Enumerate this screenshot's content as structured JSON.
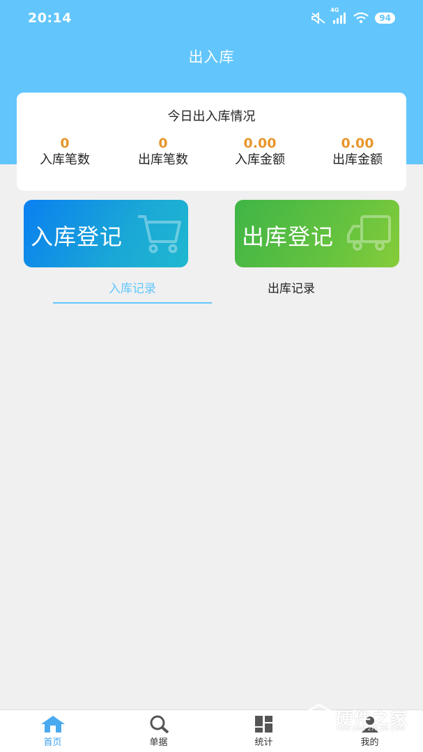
{
  "status_bar": {
    "time": "20:14",
    "network": "4G",
    "battery": "94",
    "icons": [
      "mute-icon",
      "signal-icon",
      "wifi-icon",
      "battery-icon"
    ]
  },
  "header": {
    "title": "出入库",
    "bg_color": "#62c6fc"
  },
  "summary": {
    "title": "今日出入库情况",
    "value_color": "#e8962c",
    "stats": [
      {
        "value": "0",
        "label": "入库笔数"
      },
      {
        "value": "0",
        "label": "出库笔数"
      },
      {
        "value": "0.00",
        "label": "入库金额"
      },
      {
        "value": "0.00",
        "label": "出库金额"
      }
    ]
  },
  "actions": {
    "stock_in": {
      "label": "入库登记",
      "icon": "cart-icon"
    },
    "stock_out": {
      "label": "出库登记",
      "icon": "truck-icon"
    }
  },
  "tabs": [
    {
      "label": "入库记录",
      "active": true
    },
    {
      "label": "出库记录",
      "active": false
    }
  ],
  "bottom_nav": [
    {
      "label": "首页",
      "icon": "home-icon",
      "active": true
    },
    {
      "label": "单据",
      "icon": "search-icon",
      "active": false
    },
    {
      "label": "统计",
      "icon": "grid-icon",
      "active": false
    },
    {
      "label": "我的",
      "icon": "user-icon",
      "active": false
    }
  ],
  "watermark": {
    "text": "硬件之家",
    "sub": "YING JIAN ZHI JIA.COM"
  }
}
